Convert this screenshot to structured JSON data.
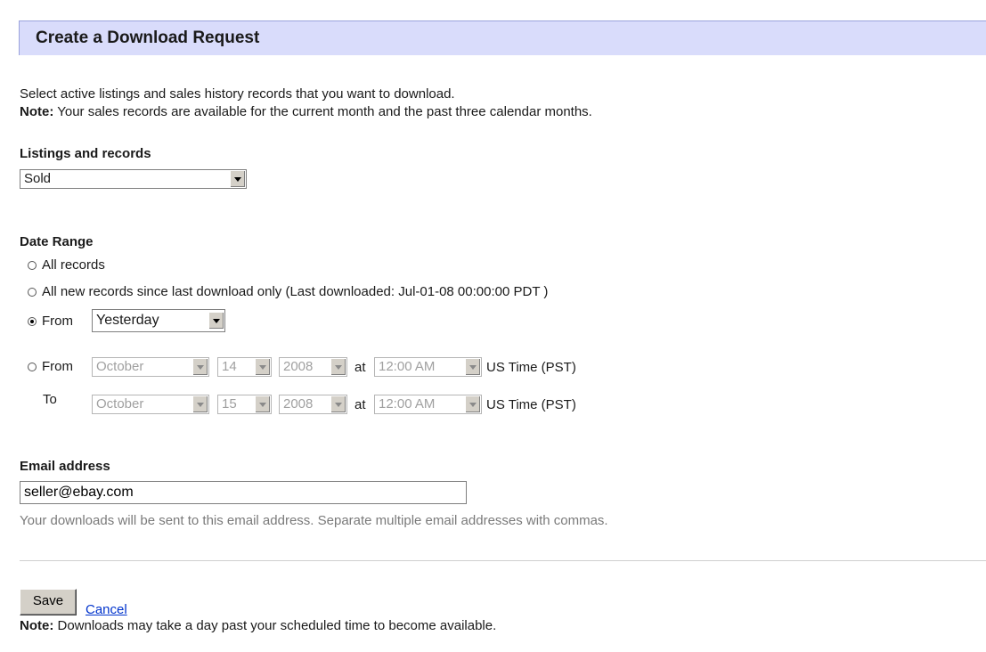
{
  "header": {
    "title": "Create a Download Request"
  },
  "intro": {
    "line1": "Select active listings and sales history records that you want to download.",
    "note_label": "Note:",
    "note_text": " Your sales records are available for the current month and the past three calendar months."
  },
  "listings": {
    "label": "Listings and records",
    "selected": "Sold"
  },
  "date_range": {
    "label": "Date Range",
    "opt_all": "All records",
    "opt_new": "All new records since last download only (Last downloaded: Jul-01-08 00:00:00 PDT )",
    "opt_from": "From",
    "from_preset": "Yesterday",
    "opt_custom": "From",
    "to_label": "To",
    "at": "at",
    "tz": "US Time (PST)",
    "from_month": "October",
    "from_day": "14",
    "from_year": "2008",
    "from_time": "12:00 AM",
    "to_month": "October",
    "to_day": "15",
    "to_year": "2008",
    "to_time": "12:00 AM",
    "selected_option": "from_preset"
  },
  "email": {
    "label": "Email address",
    "value": "seller@ebay.com",
    "hint": "Your downloads will be sent to this email address. Separate multiple email addresses with commas."
  },
  "actions": {
    "save": "Save",
    "cancel": "Cancel"
  },
  "footer": {
    "note_label": "Note:",
    "note_text": " Downloads may take a day past your scheduled time to become available."
  },
  "colors": {
    "header_bg": "#d9dcfb",
    "link": "#0033cc",
    "hint": "#7a7a7a"
  }
}
